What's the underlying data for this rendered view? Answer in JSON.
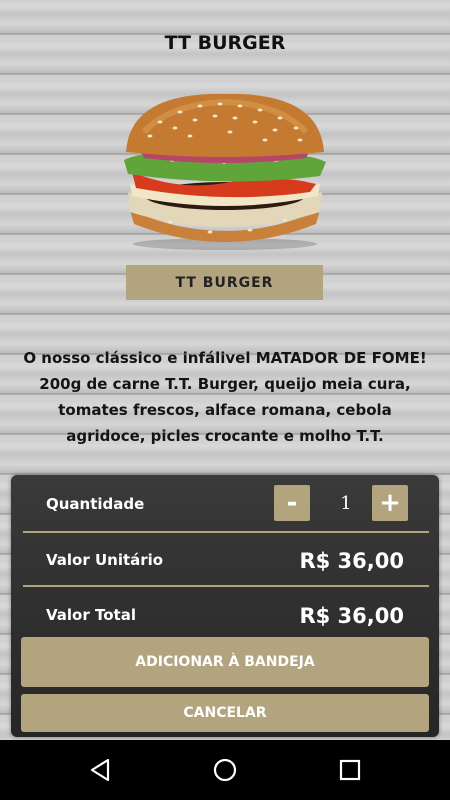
{
  "header": {
    "title": "TT BURGER"
  },
  "product": {
    "name": "TT BURGER",
    "description": "O nosso clássico e infálivel MATADOR DE FOME! 200g de carne T.T. Burger, queijo meia cura, tomates frescos, alface romana, cebola agridoce, picles crocante e molho T.T."
  },
  "order": {
    "quantity_label": "Quantidade",
    "minus_label": "-",
    "plus_label": "+",
    "quantity": "1",
    "unit_label": "Valor Unitário",
    "unit_price": "R$ 36,00",
    "total_label": "Valor Total",
    "total_price": "R$ 36,00"
  },
  "actions": {
    "add_label": "ADICIONAR À BANDEJA",
    "cancel_label": "CANCELAR"
  },
  "theme": {
    "accent": "#b2a47f",
    "panel": "#2f2f2f"
  },
  "navbar": {
    "icons": [
      "back-icon",
      "home-icon",
      "recents-icon"
    ]
  }
}
